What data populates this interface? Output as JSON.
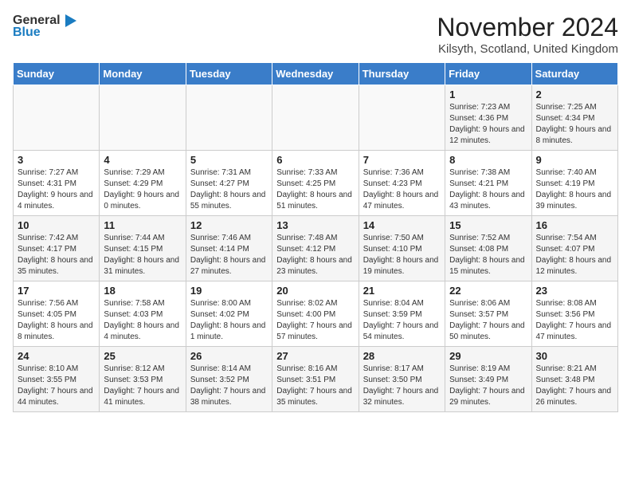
{
  "header": {
    "logo_general": "General",
    "logo_blue": "Blue",
    "title": "November 2024",
    "location": "Kilsyth, Scotland, United Kingdom"
  },
  "days_of_week": [
    "Sunday",
    "Monday",
    "Tuesday",
    "Wednesday",
    "Thursday",
    "Friday",
    "Saturday"
  ],
  "weeks": [
    [
      {
        "day": "",
        "info": ""
      },
      {
        "day": "",
        "info": ""
      },
      {
        "day": "",
        "info": ""
      },
      {
        "day": "",
        "info": ""
      },
      {
        "day": "",
        "info": ""
      },
      {
        "day": "1",
        "info": "Sunrise: 7:23 AM\nSunset: 4:36 PM\nDaylight: 9 hours and 12 minutes."
      },
      {
        "day": "2",
        "info": "Sunrise: 7:25 AM\nSunset: 4:34 PM\nDaylight: 9 hours and 8 minutes."
      }
    ],
    [
      {
        "day": "3",
        "info": "Sunrise: 7:27 AM\nSunset: 4:31 PM\nDaylight: 9 hours and 4 minutes."
      },
      {
        "day": "4",
        "info": "Sunrise: 7:29 AM\nSunset: 4:29 PM\nDaylight: 9 hours and 0 minutes."
      },
      {
        "day": "5",
        "info": "Sunrise: 7:31 AM\nSunset: 4:27 PM\nDaylight: 8 hours and 55 minutes."
      },
      {
        "day": "6",
        "info": "Sunrise: 7:33 AM\nSunset: 4:25 PM\nDaylight: 8 hours and 51 minutes."
      },
      {
        "day": "7",
        "info": "Sunrise: 7:36 AM\nSunset: 4:23 PM\nDaylight: 8 hours and 47 minutes."
      },
      {
        "day": "8",
        "info": "Sunrise: 7:38 AM\nSunset: 4:21 PM\nDaylight: 8 hours and 43 minutes."
      },
      {
        "day": "9",
        "info": "Sunrise: 7:40 AM\nSunset: 4:19 PM\nDaylight: 8 hours and 39 minutes."
      }
    ],
    [
      {
        "day": "10",
        "info": "Sunrise: 7:42 AM\nSunset: 4:17 PM\nDaylight: 8 hours and 35 minutes."
      },
      {
        "day": "11",
        "info": "Sunrise: 7:44 AM\nSunset: 4:15 PM\nDaylight: 8 hours and 31 minutes."
      },
      {
        "day": "12",
        "info": "Sunrise: 7:46 AM\nSunset: 4:14 PM\nDaylight: 8 hours and 27 minutes."
      },
      {
        "day": "13",
        "info": "Sunrise: 7:48 AM\nSunset: 4:12 PM\nDaylight: 8 hours and 23 minutes."
      },
      {
        "day": "14",
        "info": "Sunrise: 7:50 AM\nSunset: 4:10 PM\nDaylight: 8 hours and 19 minutes."
      },
      {
        "day": "15",
        "info": "Sunrise: 7:52 AM\nSunset: 4:08 PM\nDaylight: 8 hours and 15 minutes."
      },
      {
        "day": "16",
        "info": "Sunrise: 7:54 AM\nSunset: 4:07 PM\nDaylight: 8 hours and 12 minutes."
      }
    ],
    [
      {
        "day": "17",
        "info": "Sunrise: 7:56 AM\nSunset: 4:05 PM\nDaylight: 8 hours and 8 minutes."
      },
      {
        "day": "18",
        "info": "Sunrise: 7:58 AM\nSunset: 4:03 PM\nDaylight: 8 hours and 4 minutes."
      },
      {
        "day": "19",
        "info": "Sunrise: 8:00 AM\nSunset: 4:02 PM\nDaylight: 8 hours and 1 minute."
      },
      {
        "day": "20",
        "info": "Sunrise: 8:02 AM\nSunset: 4:00 PM\nDaylight: 7 hours and 57 minutes."
      },
      {
        "day": "21",
        "info": "Sunrise: 8:04 AM\nSunset: 3:59 PM\nDaylight: 7 hours and 54 minutes."
      },
      {
        "day": "22",
        "info": "Sunrise: 8:06 AM\nSunset: 3:57 PM\nDaylight: 7 hours and 50 minutes."
      },
      {
        "day": "23",
        "info": "Sunrise: 8:08 AM\nSunset: 3:56 PM\nDaylight: 7 hours and 47 minutes."
      }
    ],
    [
      {
        "day": "24",
        "info": "Sunrise: 8:10 AM\nSunset: 3:55 PM\nDaylight: 7 hours and 44 minutes."
      },
      {
        "day": "25",
        "info": "Sunrise: 8:12 AM\nSunset: 3:53 PM\nDaylight: 7 hours and 41 minutes."
      },
      {
        "day": "26",
        "info": "Sunrise: 8:14 AM\nSunset: 3:52 PM\nDaylight: 7 hours and 38 minutes."
      },
      {
        "day": "27",
        "info": "Sunrise: 8:16 AM\nSunset: 3:51 PM\nDaylight: 7 hours and 35 minutes."
      },
      {
        "day": "28",
        "info": "Sunrise: 8:17 AM\nSunset: 3:50 PM\nDaylight: 7 hours and 32 minutes."
      },
      {
        "day": "29",
        "info": "Sunrise: 8:19 AM\nSunset: 3:49 PM\nDaylight: 7 hours and 29 minutes."
      },
      {
        "day": "30",
        "info": "Sunrise: 8:21 AM\nSunset: 3:48 PM\nDaylight: 7 hours and 26 minutes."
      }
    ]
  ]
}
